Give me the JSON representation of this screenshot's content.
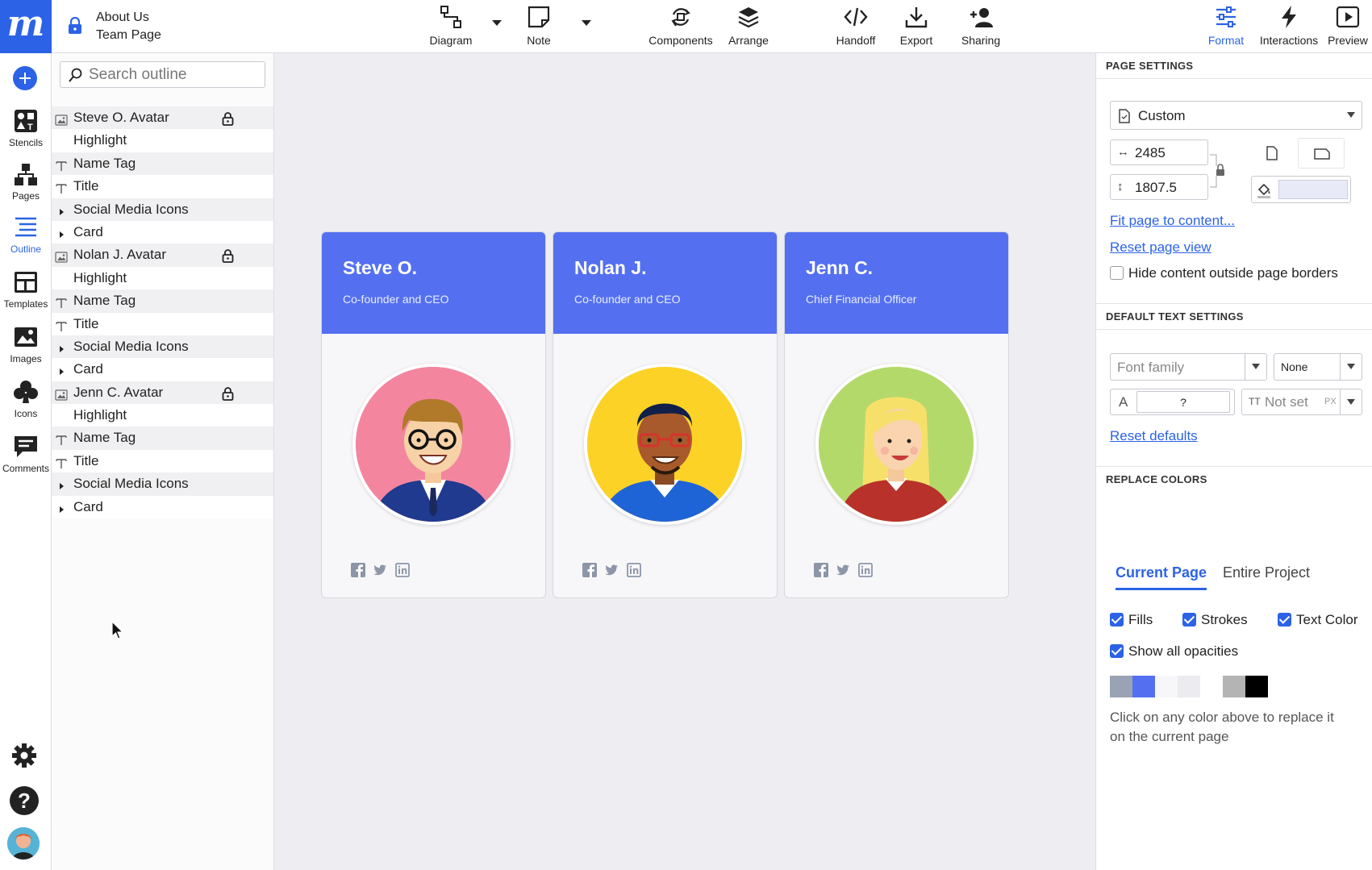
{
  "app": {
    "logo": "m",
    "document_title": "About Us",
    "page_name": "Team Page"
  },
  "toolbar": {
    "diagram": "Diagram",
    "note": "Note",
    "components": "Components",
    "arrange": "Arrange",
    "handoff": "Handoff",
    "export": "Export",
    "sharing": "Sharing",
    "format": "Format",
    "interactions": "Interactions",
    "preview": "Preview"
  },
  "rail": {
    "stencils": "Stencils",
    "pages": "Pages",
    "outline": "Outline",
    "templates": "Templates",
    "images": "Images",
    "icons": "Icons",
    "comments": "Comments"
  },
  "outline": {
    "search_placeholder": "Search outline",
    "items": [
      {
        "label": "Steve O. Avatar",
        "icon": "image-icon",
        "locked": true
      },
      {
        "label": "Highlight",
        "icon": "",
        "locked": false
      },
      {
        "label": "Name Tag",
        "icon": "text-icon",
        "locked": false
      },
      {
        "label": "Title",
        "icon": "text-icon",
        "locked": false
      },
      {
        "label": "Social Media Icons",
        "icon": "expand-arrow-icon",
        "locked": false
      },
      {
        "label": "Card",
        "icon": "expand-arrow-icon",
        "locked": false
      },
      {
        "label": "Nolan J. Avatar",
        "icon": "image-icon",
        "locked": true
      },
      {
        "label": "Highlight",
        "icon": "",
        "locked": false
      },
      {
        "label": "Name Tag",
        "icon": "text-icon",
        "locked": false
      },
      {
        "label": "Title",
        "icon": "text-icon",
        "locked": false
      },
      {
        "label": "Social Media Icons",
        "icon": "expand-arrow-icon",
        "locked": false
      },
      {
        "label": "Card",
        "icon": "expand-arrow-icon",
        "locked": false
      },
      {
        "label": "Jenn C. Avatar",
        "icon": "image-icon",
        "locked": true
      },
      {
        "label": "Highlight",
        "icon": "",
        "locked": false
      },
      {
        "label": "Name Tag",
        "icon": "text-icon",
        "locked": false
      },
      {
        "label": "Title",
        "icon": "text-icon",
        "locked": false
      },
      {
        "label": "Social Media Icons",
        "icon": "expand-arrow-icon",
        "locked": false
      },
      {
        "label": "Card",
        "icon": "expand-arrow-icon",
        "locked": false
      }
    ]
  },
  "canvas": {
    "cards": [
      {
        "name": "Steve O.",
        "title": "Co-founder and CEO",
        "portrait_bg": "#f4859f"
      },
      {
        "name": "Nolan J.",
        "title": "Co-founder and CEO",
        "portrait_bg": "#fcd227"
      },
      {
        "name": "Jenn C.",
        "title": "Chief Financial Officer",
        "portrait_bg": "#b3d96b"
      }
    ],
    "card_header_color": "#5470f1"
  },
  "format_panel": {
    "page_settings": {
      "heading": "PAGE SETTINGS",
      "size_preset": "Custom",
      "width": "2485",
      "height": "1807.5",
      "fit_link": "Fit page to content...",
      "reset_link": "Reset page view",
      "hide_outside_label": "Hide content outside page borders",
      "hide_outside_checked": false
    },
    "text_settings": {
      "heading": "DEFAULT TEXT SETTINGS",
      "font_family_placeholder": "Font family",
      "font_weight": "None",
      "font_size": "?",
      "line_height_placeholder": "Not set",
      "line_height_unit": "PX",
      "reset_link": "Reset defaults"
    },
    "replace_colors": {
      "heading": "REPLACE COLORS",
      "tabs": [
        "Current Page",
        "Entire Project"
      ],
      "fills": "Fills",
      "strokes": "Strokes",
      "text_color": "Text Color",
      "show_all_opacities": "Show all opacities",
      "swatches": [
        "#9aa3b4",
        "#5470f1",
        "#f7f7fa",
        "#ebebf0",
        "#ffffff",
        "#b4b4b4",
        "#000000"
      ],
      "hint": "Click on any color above to replace it on the current page"
    }
  },
  "colors": {
    "accent": "#2c63e6"
  }
}
